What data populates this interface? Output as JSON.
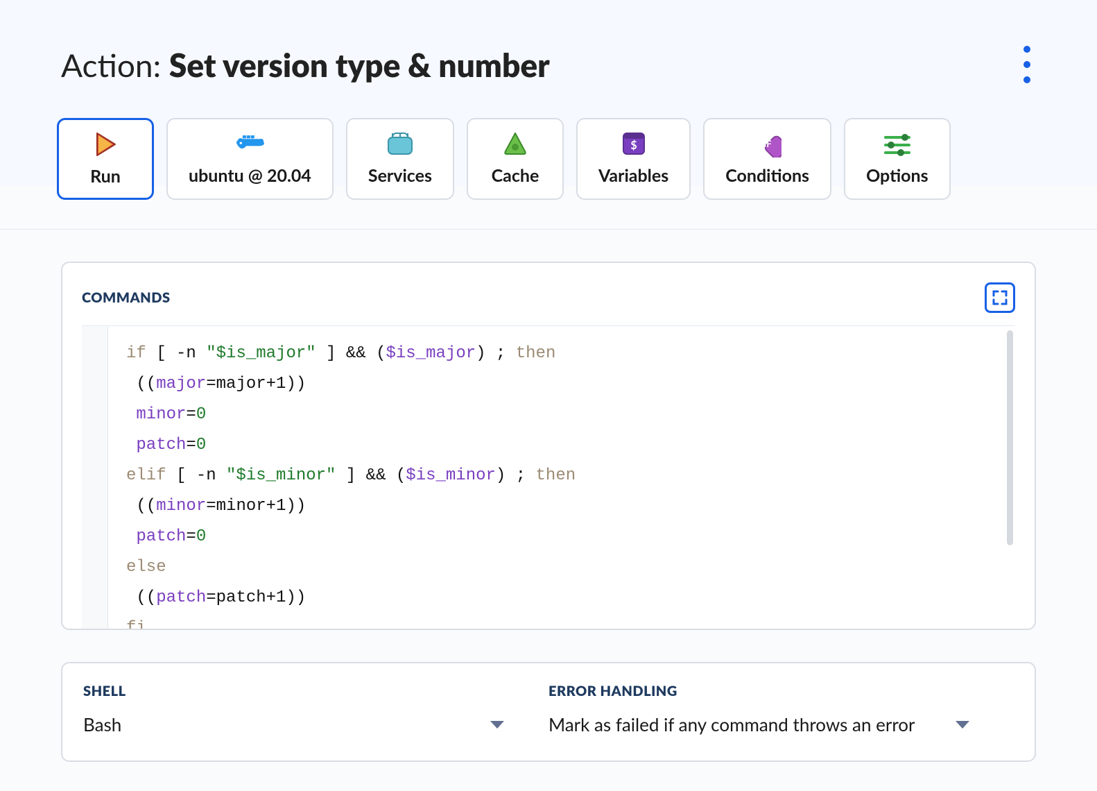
{
  "header": {
    "prefix": "Action: ",
    "title": "Set version type & number"
  },
  "tabs": [
    {
      "id": "run",
      "label": "Run",
      "active": true
    },
    {
      "id": "image",
      "label": "ubuntu @ 20.04"
    },
    {
      "id": "services",
      "label": "Services"
    },
    {
      "id": "cache",
      "label": "Cache"
    },
    {
      "id": "variables",
      "label": "Variables"
    },
    {
      "id": "conditions",
      "label": "Conditions"
    },
    {
      "id": "options",
      "label": "Options"
    }
  ],
  "commands": {
    "title": "COMMANDS",
    "code": [
      {
        "t": "kw",
        "v": "if"
      },
      {
        "t": "op",
        "v": " [ -n "
      },
      {
        "t": "str",
        "v": "\"$is_major\""
      },
      {
        "t": "op",
        "v": " ] && ("
      },
      {
        "t": "var",
        "v": "$is_major"
      },
      {
        "t": "op",
        "v": ") ; "
      },
      {
        "t": "kw",
        "v": "then"
      },
      {
        "t": "nl"
      },
      {
        "t": "op",
        "v": " (("
      },
      {
        "t": "var",
        "v": "major"
      },
      {
        "t": "op",
        "v": "=major+1))"
      },
      {
        "t": "nl"
      },
      {
        "t": "op",
        "v": " "
      },
      {
        "t": "var",
        "v": "minor"
      },
      {
        "t": "op",
        "v": "="
      },
      {
        "t": "num",
        "v": "0"
      },
      {
        "t": "nl"
      },
      {
        "t": "op",
        "v": " "
      },
      {
        "t": "var",
        "v": "patch"
      },
      {
        "t": "op",
        "v": "="
      },
      {
        "t": "num",
        "v": "0"
      },
      {
        "t": "nl"
      },
      {
        "t": "kw",
        "v": "elif"
      },
      {
        "t": "op",
        "v": " [ -n "
      },
      {
        "t": "str",
        "v": "\"$is_minor\""
      },
      {
        "t": "op",
        "v": " ] && ("
      },
      {
        "t": "var",
        "v": "$is_minor"
      },
      {
        "t": "op",
        "v": ") ; "
      },
      {
        "t": "kw",
        "v": "then"
      },
      {
        "t": "nl"
      },
      {
        "t": "op",
        "v": " (("
      },
      {
        "t": "var",
        "v": "minor"
      },
      {
        "t": "op",
        "v": "=minor+1))"
      },
      {
        "t": "nl"
      },
      {
        "t": "op",
        "v": " "
      },
      {
        "t": "var",
        "v": "patch"
      },
      {
        "t": "op",
        "v": "="
      },
      {
        "t": "num",
        "v": "0"
      },
      {
        "t": "nl"
      },
      {
        "t": "kw",
        "v": "else"
      },
      {
        "t": "nl"
      },
      {
        "t": "op",
        "v": " (("
      },
      {
        "t": "var",
        "v": "patch"
      },
      {
        "t": "op",
        "v": "=patch+1))"
      },
      {
        "t": "nl"
      },
      {
        "t": "kw",
        "v": "fi"
      }
    ]
  },
  "shell": {
    "label": "SHELL",
    "value": "Bash"
  },
  "error_handling": {
    "label": "ERROR HANDLING",
    "value": "Mark as failed if any command throws an error"
  }
}
